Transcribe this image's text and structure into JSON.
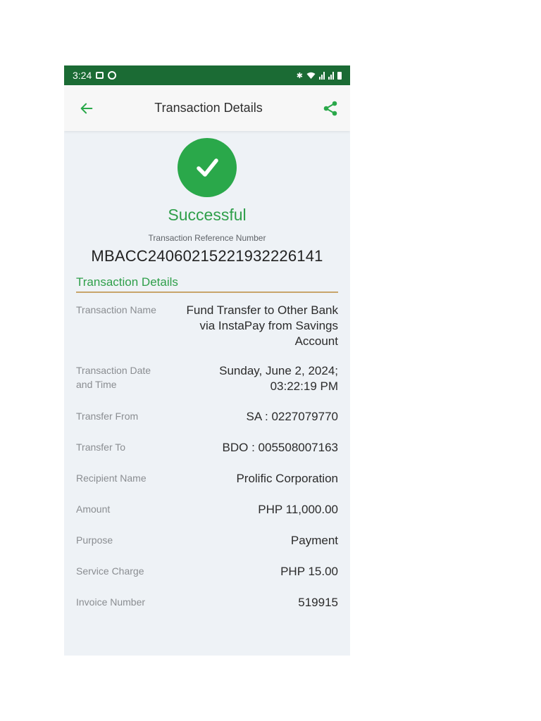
{
  "status_bar": {
    "time": "3:24"
  },
  "app_bar": {
    "title": "Transaction Details",
    "back_icon": "arrow-left-icon",
    "share_icon": "share-icon"
  },
  "result": {
    "status": "Successful",
    "icon": "check-circle-icon",
    "ref_label": "Transaction Reference Number",
    "ref_number": "MBACC2406021522193222614​1"
  },
  "section": {
    "title": "Transaction Details"
  },
  "details": [
    {
      "label": "Transaction Name",
      "value": "Fund Transfer to Other Bank via InstaPay from Savings Account"
    },
    {
      "label": "Transaction Date and Time",
      "value": "Sunday, June 2, 2024; 03:22:19 PM"
    },
    {
      "label": "Transfer From",
      "value": "SA : 0227079770"
    },
    {
      "label": "Transfer To",
      "value": "BDO : 005508007163"
    },
    {
      "label": "Recipient Name",
      "value": "Prolific Corporation"
    },
    {
      "label": "Amount",
      "value": "PHP 11,000.00"
    },
    {
      "label": "Purpose",
      "value": "Payment"
    },
    {
      "label": "Service Charge",
      "value": "PHP 15.00"
    },
    {
      "label": "Invoice Number",
      "value": "519915"
    }
  ],
  "colors": {
    "status_bar": "#1b6b34",
    "accent_green": "#2aa84a",
    "divider_gold": "#c8a56b"
  }
}
